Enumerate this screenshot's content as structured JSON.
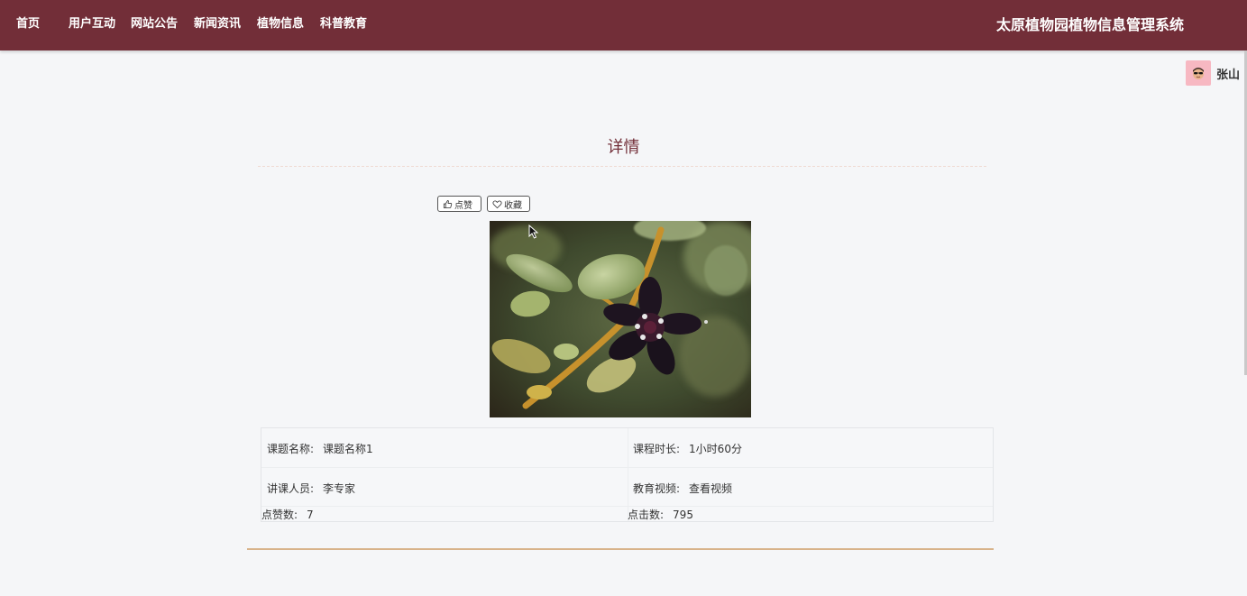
{
  "nav": {
    "items": [
      "首页",
      "用户互动",
      "网站公告",
      "新闻资讯",
      "植物信息",
      "科普教育"
    ],
    "site_title": "太原植物园植物信息管理系统"
  },
  "user": {
    "name": "张山",
    "avatar_icon": "avatar-face-icon"
  },
  "detail": {
    "title": "详情",
    "like_label": "点赞",
    "favorite_label": "收藏",
    "like_icon": "thumbs-up-icon",
    "favorite_icon": "heart-icon"
  },
  "info": {
    "topic_label": "课题名称:",
    "topic_value": "课题名称1",
    "duration_label": "课程时长:",
    "duration_value": "1小时60分",
    "lecturer_label": "讲课人员:",
    "lecturer_value": "李专家",
    "video_label": "教育视频:",
    "video_value": "查看视频",
    "likes_label": "点赞数:",
    "likes_value": "7",
    "clicks_label": "点击数:",
    "clicks_value": "795"
  },
  "colors": {
    "header_bg": "#722e38",
    "accent": "#722e38",
    "bottom_rule": "#d8b38a",
    "avatar_bg": "#f7b8c2"
  }
}
